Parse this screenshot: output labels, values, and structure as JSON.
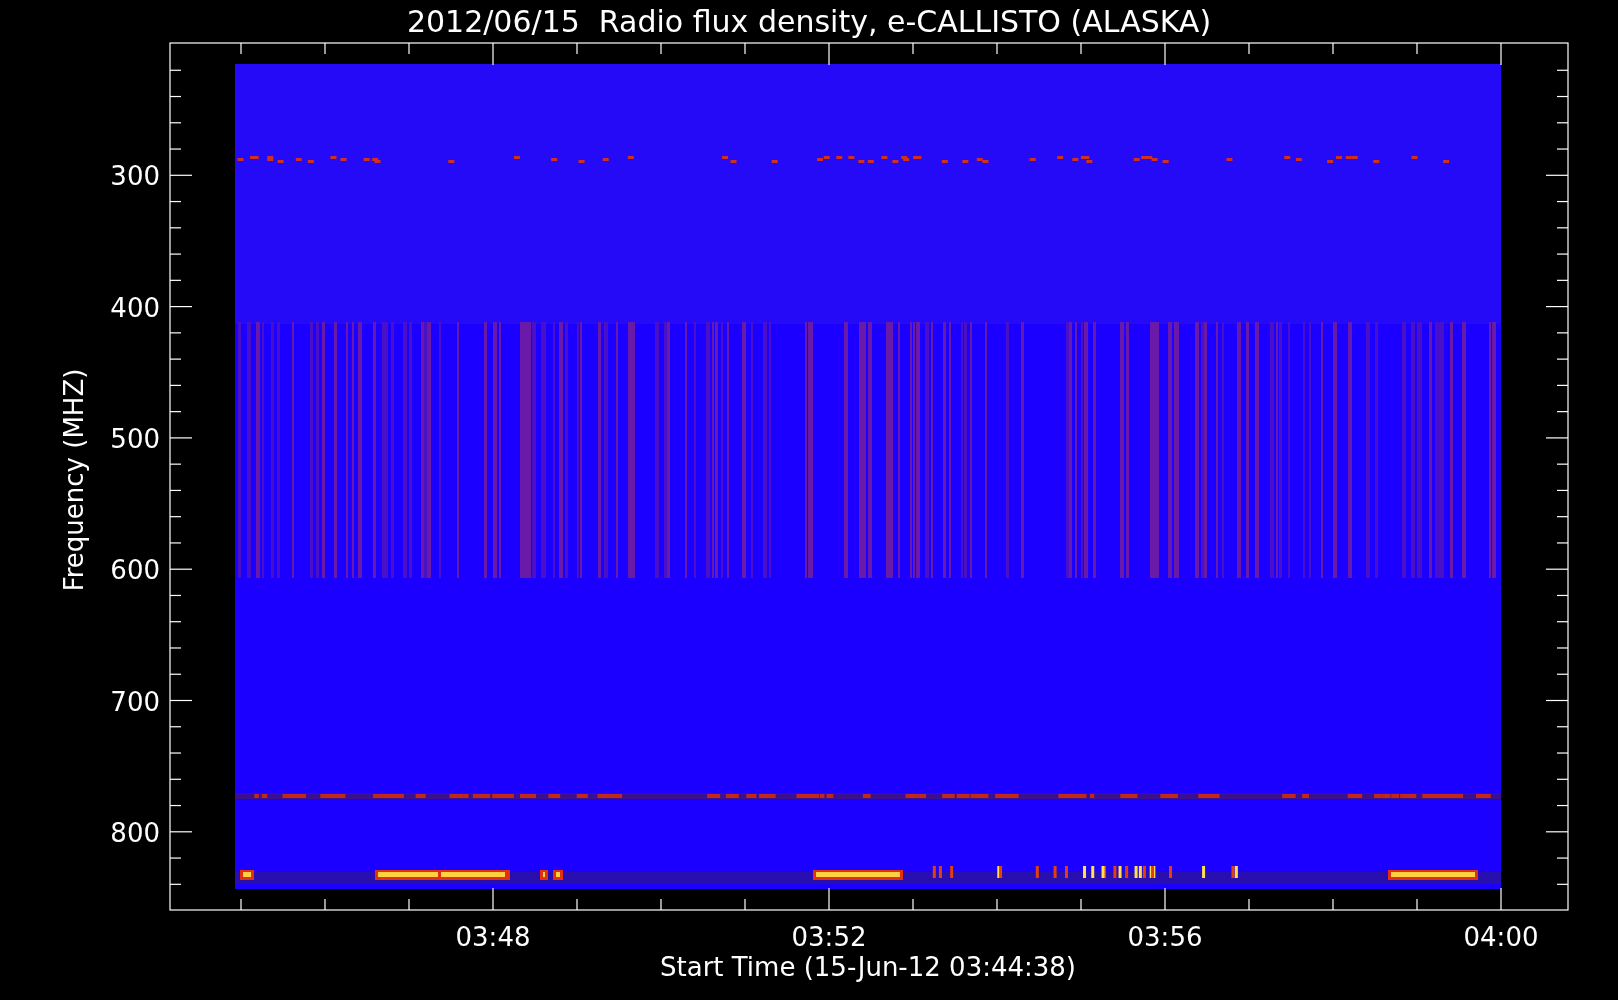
{
  "title": "2012/06/15  Radio flux density, e-CALLISTO (ALASKA)",
  "y_axis": {
    "label": "Frequency (MHZ)",
    "ticks": [
      "300",
      "400",
      "500",
      "600",
      "700",
      "800"
    ]
  },
  "x_axis": {
    "label": "Start Time (15-Jun-12 03:44:38)",
    "ticks": [
      "03:48",
      "03:52",
      "03:56",
      "04:00"
    ]
  }
}
